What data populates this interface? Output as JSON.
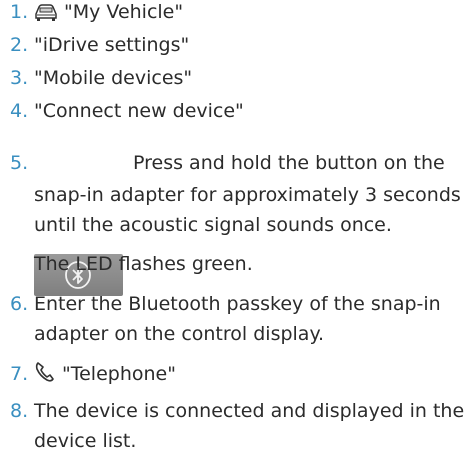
{
  "steps": [
    {
      "number": "1.",
      "text": "\"My Vehicle\"",
      "icon": "car-icon"
    },
    {
      "number": "2.",
      "text": "\"iDrive settings\""
    },
    {
      "number": "3.",
      "text": "\"Mobile devices\""
    },
    {
      "number": "4.",
      "text": "\"Connect new device\""
    },
    {
      "number": "5.",
      "icon": "bluetooth-button-icon",
      "text_lines": [
        "Press and hold the button on the",
        "snap-in adapter for approximately 3 seconds",
        "until the acoustic signal sounds once."
      ],
      "note": "The LED flashes green."
    },
    {
      "number": "6.",
      "text_lines": [
        "Enter the Bluetooth passkey of the snap-in",
        "adapter on the control display."
      ]
    },
    {
      "number": "7.",
      "text": "\"Telephone\"",
      "icon": "telephone-icon"
    },
    {
      "number": "8.",
      "text_lines": [
        "The device is connected and displayed in the",
        "device list."
      ]
    }
  ],
  "colors": {
    "step_number": "#3a8fc0",
    "text": "#2b2b2b",
    "button_fill": "#8c8c8c"
  }
}
